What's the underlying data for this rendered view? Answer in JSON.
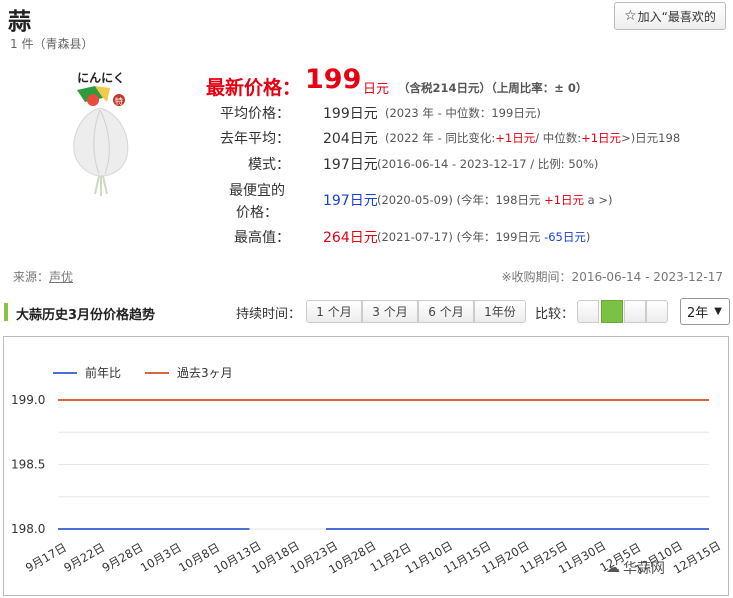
{
  "header": {
    "title": "蒜",
    "subtitle": "1 件（青森县）",
    "favorite_label": "加入“最喜欢的"
  },
  "product_image": {
    "label_text": "にんにく",
    "badge_text": "特"
  },
  "price": {
    "latest_label": "最新价格：",
    "latest_value": "199",
    "latest_unit": "日元",
    "latest_extra": "（含税214日元）（上周比率：± 0）",
    "rows": [
      {
        "label": "平均价格：",
        "value": "199日元",
        "detail": "(2023 年 - 中位数：199日元)"
      },
      {
        "label": "去年平均：",
        "value": "204日元",
        "detail_pre": "(2022 年 - 同比变化:",
        "detail_red1": "+1日元",
        "detail_mid": "/ 中位数:",
        "detail_red2": "+1日元",
        "detail_post": ">)日元198"
      },
      {
        "label": "模式：",
        "value": "197日元",
        "detail": "(2016-06-14 - 2023-12-17 / 比例: 50%)"
      },
      {
        "label": "最便宜的价格：",
        "value": "197日元",
        "detail_pre": "(2020-05-09)  (今年：198日元 ",
        "detail_red": "+1日元",
        "detail_post": " a >)"
      },
      {
        "label": "最高值：",
        "value": "264日元",
        "detail_pre": "(2021-07-17)  (今年：199日元 ",
        "detail_blue": "-65日元",
        "detail_post": ")"
      }
    ]
  },
  "meta": {
    "source_label": "来源：",
    "source_link": "声优",
    "period": "※收购期间：2016-06-14 - 2023-12-17"
  },
  "toolbar": {
    "chart_title": "大蒜历史3月份价格趋势",
    "duration_label": "持续时间：",
    "durations": [
      "1 个月",
      "3 个月",
      "6 个月",
      "1年份"
    ],
    "compare_label": "比较：",
    "range_select": "2年"
  },
  "colors": {
    "accent_green": "#8bc34a",
    "price_red": "#e60012",
    "series_blue": "#4a6fd6",
    "series_orange": "#d9653b"
  },
  "watermark": "华蒜网",
  "chart_data": {
    "type": "line",
    "x": [
      "9月17日",
      "9月22日",
      "9月28日",
      "10月3日",
      "10月8日",
      "10月13日",
      "10月18日",
      "10月23日",
      "10月28日",
      "11月2日",
      "11月10日",
      "11月15日",
      "11月20日",
      "11月25日",
      "11月30日",
      "12月5日",
      "12月10日",
      "12月15日"
    ],
    "series": [
      {
        "name": "前年比",
        "color": "#4a6fd6",
        "values": [
          198,
          198,
          198,
          198,
          198,
          198,
          null,
          198,
          198,
          198,
          198,
          198,
          198,
          198,
          198,
          198,
          198,
          198
        ]
      },
      {
        "name": "過去3ヶ月",
        "color": "#d9653b",
        "values": [
          199,
          199,
          199,
          199,
          199,
          199,
          199,
          199,
          199,
          199,
          199,
          199,
          199,
          199,
          199,
          199,
          199,
          199
        ]
      }
    ],
    "yticks": [
      "199.0",
      "198.5",
      "198.0"
    ],
    "ylim": [
      198.0,
      199.0
    ],
    "legend": "top-left",
    "grid": true
  }
}
